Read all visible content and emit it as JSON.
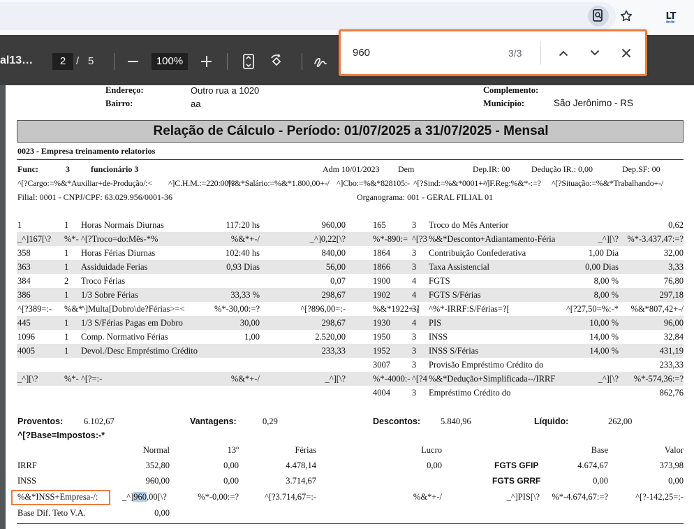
{
  "browser": {
    "icons": [
      "zoom-lens-icon",
      "star-icon",
      "extension-icon"
    ],
    "extension_label": "LT",
    "extension_wave": "≈≈"
  },
  "pdf_toolbar": {
    "title": "al13…",
    "page_current": "2",
    "page_separator": "/",
    "page_total": "5",
    "zoom": "100%"
  },
  "find": {
    "query": "960",
    "count": "3/3"
  },
  "colors": {
    "highlight_orange": "#ef7b3c",
    "highlight_blue": "#b3cdea",
    "toolbar_bg": "#3c3c3c",
    "band_gray": "#c6c6c6"
  },
  "header": {
    "endereco_label": "Endereço:",
    "endereco_value": "Outro rua a 1020",
    "complemento_label": "Complemento:",
    "bairro_label": "Bairro:",
    "bairro_value": "aa",
    "municipio_label": "Município:",
    "municipio_value": "São Jerônimo - RS"
  },
  "report_title": "Relação de Cálculo - Período: 01/07/2025 a 31/07/2025 - Mensal",
  "company": "0023 - Empresa treinamento relatorios",
  "employee": {
    "func_label": "Func:",
    "func_number": "3",
    "func_name": "funcionário 3",
    "adm": "Adm 10/01/2023",
    "dem": "Dem",
    "dep_ir": "Dep.IR:  00",
    "deducao_ir": "Dedução IR.: 0,00",
    "dep_sf": "Dep.SF:  00",
    "line2_a": "^[?Cargo:=%&*Auxiliar+de-Produção/:<",
    "line2_b": "^]C.H.M.:=220:00[?",
    "line2_c": "%&*Salário:=%&*1.800,00+-/",
    "line2_d": "^]Cbo:=%&*828105:-",
    "line2_e": "^[?Sind:=%&*0001+-/",
    "line2_f": "^]F.Reg:%&*-:=?",
    "line2_g": "^[?Situação:=%&*Trabalhando+-/",
    "filial": "Filial: 0001 - CNPJ/CPF: 63.029.956/0001-36",
    "organograma": "Organograma: 001 - GERAL FILIAL 01"
  },
  "left_rows": [
    {
      "code": "1",
      "tipo": "1",
      "desc": "Horas Normais Diurnas",
      "ref": "117:20 hs",
      "valor": "960,00"
    },
    {
      "code": "_^]167[\\?",
      "tipo": "%*-",
      "desc": "^[?Troco=do:Mês-*%",
      "ref": "%&*+-/",
      "valor": "_^]0,22[\\?"
    },
    {
      "code": "358",
      "tipo": "1",
      "desc": "Horas Férias Diurnas",
      "ref": "102:40 hs",
      "valor": "840,00"
    },
    {
      "code": "363",
      "tipo": "1",
      "desc": "Assiduidade Ferias",
      "ref": "0,93 Dias",
      "valor": "56,00"
    },
    {
      "code": "384",
      "tipo": "2",
      "desc": "Troco Férias",
      "ref": "",
      "valor": "0,07"
    },
    {
      "code": "386",
      "tipo": "1",
      "desc": "1/3 Sobre Férias",
      "ref": "33,33 %",
      "valor": "298,67"
    },
    {
      "code": "^[?389=:-",
      "tipo": "%&*",
      "desc": "^]Multa[Dobro\\de?Férias>=<",
      "ref": "%*-30,00:=?",
      "valor": "^[?896,00=:-"
    },
    {
      "code": "445",
      "tipo": "1",
      "desc": "1/3 S/Férias Pagas em Dobro",
      "ref": "30,00",
      "valor": "298,67"
    },
    {
      "code": "1096",
      "tipo": "1",
      "desc": "Comp. Normativo Férias",
      "ref": "1,00",
      "valor": "2.520,00"
    },
    {
      "code": "4005",
      "tipo": "1",
      "desc": "Devol./Desc Empréstimo Crédito",
      "ref": "",
      "valor": "233,33"
    },
    {
      "code": "",
      "tipo": "",
      "desc": "",
      "ref": "",
      "valor": ""
    },
    {
      "code": "_^][\\?",
      "tipo": "%*-",
      "desc": "^[?=:-",
      "ref": "%&*+-/",
      "valor": "_^][\\?"
    },
    {
      "code": "",
      "tipo": "",
      "desc": "",
      "ref": "",
      "valor": ""
    }
  ],
  "right_rows": [
    {
      "code": "165",
      "tipo": "3",
      "desc": "Troco do Mês Anterior",
      "ref": "",
      "valor": "0,62"
    },
    {
      "code": "%*-890:=",
      "tipo": "^[?3",
      "desc": "%&*Desconto+Adiantamento-Féria",
      "ref": "_^][\\?",
      "valor": "%*-3.437,47:=?"
    },
    {
      "code": "1864",
      "tipo": "3",
      "desc": "Contribuição Confederativa",
      "ref": "1,00 Dia",
      "valor": "32,00"
    },
    {
      "code": "1866",
      "tipo": "3",
      "desc": "Taxa Assistencial",
      "ref": "0,00 Dias",
      "valor": "3,33"
    },
    {
      "code": "1900",
      "tipo": "4",
      "desc": "FGTS",
      "ref": "8,00 %",
      "valor": "76,80"
    },
    {
      "code": "1902",
      "tipo": "4",
      "desc": "FGTS S/Férias",
      "ref": "8,00 %",
      "valor": "297,18"
    },
    {
      "code": "%&*1922+-/",
      "tipo": "3]",
      "desc": "^%*-IRRF:S/Férias=?[",
      "ref": "^[?27,50=%:-*",
      "valor": "%&*807,42+-/"
    },
    {
      "code": "1930",
      "tipo": "4",
      "desc": "PIS",
      "ref": "10,00 %",
      "valor": "96,00"
    },
    {
      "code": "1950",
      "tipo": "3",
      "desc": "INSS",
      "ref": "14,00 %",
      "valor": "32,84"
    },
    {
      "code": "1952",
      "tipo": "3",
      "desc": "INSS S/Férias",
      "ref": "14,00 %",
      "valor": "431,19"
    },
    {
      "code": "3007",
      "tipo": "3",
      "desc": "Provisão Empréstimo Crédito do",
      "ref": "",
      "valor": "233,33"
    },
    {
      "code": "%*-4000:-",
      "tipo": "^[?4",
      "desc": "%&*Dedução+Simplificada--/IRRF",
      "ref": "_^][\\?",
      "valor": "%*-574,36:=?"
    },
    {
      "code": "4004",
      "tipo": "3",
      "desc": "Empréstimo Crédito do",
      "ref": "",
      "valor": "862,76"
    }
  ],
  "totals": {
    "proventos_label": "Proventos:",
    "proventos_value": "6.102,67",
    "vantagens_label": "Vantagens:",
    "vantagens_value": "0,29",
    "descontos_label": "Descontos:",
    "descontos_value": "5.840,96",
    "liquido_label": "Líquido:",
    "liquido_value": "262,00",
    "base_impostos": "^[?Base=Impostos:-*"
  },
  "base_headers": {
    "normal": "Normal",
    "decimo": "13º",
    "ferias": "Férias",
    "lucro": "Lucro",
    "base": "Base",
    "valor": "Valor"
  },
  "base_rows": [
    {
      "label": "IRRF",
      "normal": "352,80",
      "decimo": "0,00",
      "ferias": "4.478,14",
      "lucro": "0,00",
      "fg_label": "FGTS GFIP",
      "base": "4.674,67",
      "valor": "373,98"
    },
    {
      "label": "INSS",
      "normal": "960,00",
      "decimo": "0,00",
      "ferias": "3.714,67",
      "lucro": "",
      "fg_label": "FGTS GRRF",
      "base": "0,00",
      "valor": "0,00"
    },
    {
      "label": "%&*INSS+Empresa-/:",
      "normal_pre": "_^]",
      "normal_match": "960",
      "normal_post": ",00[\\?",
      "decimo": "%*-0,00:=?",
      "ferias": "^[?3.714,67=:-",
      "lucro": "%&*+-/",
      "fg_label": "_^]PIS[\\?",
      "base": "%*-4.674,67:=?",
      "valor": "^[?-142,25=:-"
    },
    {
      "label": "Base Dif. Teto V.A.",
      "normal": "0,00"
    }
  ]
}
